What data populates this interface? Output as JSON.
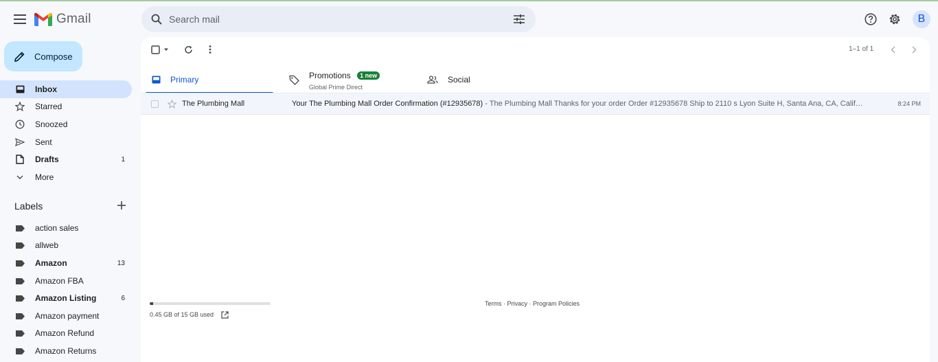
{
  "app": {
    "name": "Gmail"
  },
  "search": {
    "placeholder": "Search mail"
  },
  "account": {
    "avatar_letter": "B"
  },
  "compose": {
    "label": "Compose"
  },
  "sidebar": {
    "items": [
      {
        "label": "Inbox",
        "count": "",
        "icon": "inbox-icon"
      },
      {
        "label": "Starred",
        "count": "",
        "icon": "star-icon"
      },
      {
        "label": "Snoozed",
        "count": "",
        "icon": "clock-icon"
      },
      {
        "label": "Sent",
        "count": "",
        "icon": "send-icon"
      },
      {
        "label": "Drafts",
        "count": "1",
        "icon": "draft-icon"
      },
      {
        "label": "More",
        "count": "",
        "icon": "chevron-down-icon"
      }
    ],
    "labels_heading": "Labels",
    "labels": [
      {
        "label": "action sales",
        "count": ""
      },
      {
        "label": "allweb",
        "count": ""
      },
      {
        "label": "Amazon",
        "count": "13"
      },
      {
        "label": "Amazon FBA",
        "count": ""
      },
      {
        "label": "Amazon Listing",
        "count": "6"
      },
      {
        "label": "Amazon payment",
        "count": ""
      },
      {
        "label": "Amazon Refund",
        "count": ""
      },
      {
        "label": "Amazon Returns",
        "count": ""
      }
    ]
  },
  "toolbar": {
    "pager": "1–1 of 1"
  },
  "tabs": [
    {
      "label": "Primary",
      "sub": "",
      "badge": ""
    },
    {
      "label": "Promotions",
      "sub": "Global Prime Direct",
      "badge": "1 new"
    },
    {
      "label": "Social",
      "sub": "",
      "badge": ""
    }
  ],
  "emails": [
    {
      "sender": "The Plumbing Mall",
      "subject": "Your The Plumbing Mall Order Confirmation (#12935678)",
      "snippet": " - The Plumbing Mall Thanks for your order Order #12935678 Ship to 2110 s Lyon Suite H, Santa Ana, CA, Calif…",
      "time": "8:24 PM"
    }
  ],
  "storage": {
    "text": "0.45 GB of 15 GB used",
    "used_fraction": 0.03
  },
  "footer": {
    "terms": "Terms",
    "privacy": "Privacy",
    "program_policies": "Program Policies",
    "separator": " · "
  },
  "colors": {
    "accent": "#0b57d0",
    "compose_bg": "#c2e7ff",
    "active_nav": "#d3e3fd",
    "badge": "#188038"
  }
}
